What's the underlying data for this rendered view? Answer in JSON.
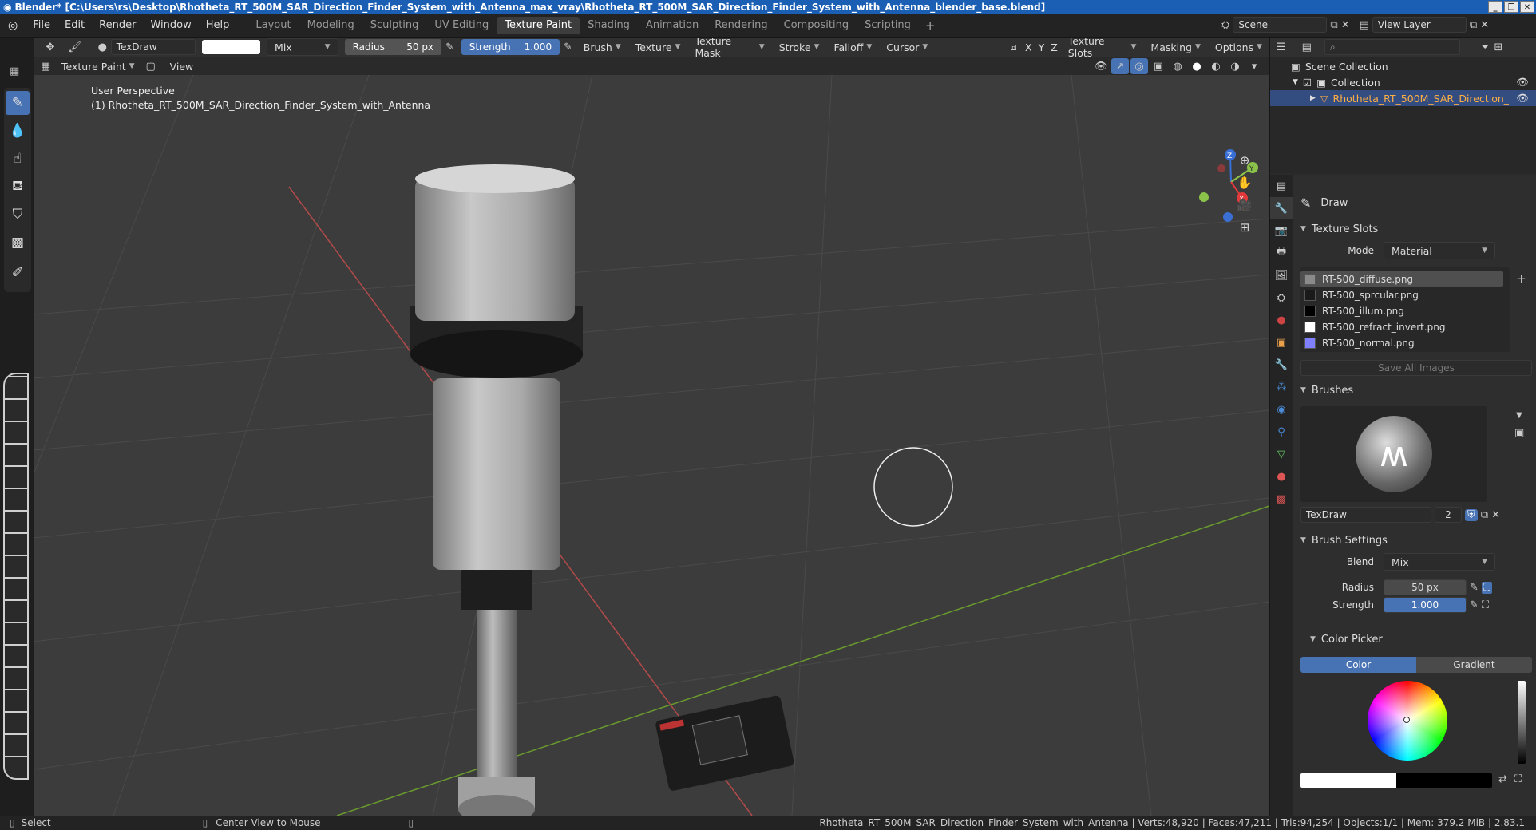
{
  "window": {
    "title": "Blender* [C:\\Users\\rs\\Desktop\\Rhotheta_RT_500M_SAR_Direction_Finder_System_with_Antenna_max_vray\\Rhotheta_RT_500M_SAR_Direction_Finder_System_with_Antenna_blender_base.blend]",
    "controls": [
      "_",
      "❐",
      "✕"
    ]
  },
  "menu": [
    "File",
    "Edit",
    "Render",
    "Window",
    "Help"
  ],
  "workspaces": [
    {
      "label": "Layout",
      "active": false
    },
    {
      "label": "Modeling",
      "active": false
    },
    {
      "label": "Sculpting",
      "active": false
    },
    {
      "label": "UV Editing",
      "active": false
    },
    {
      "label": "Texture Paint",
      "active": true
    },
    {
      "label": "Shading",
      "active": false
    },
    {
      "label": "Animation",
      "active": false
    },
    {
      "label": "Rendering",
      "active": false
    },
    {
      "label": "Compositing",
      "active": false
    },
    {
      "label": "Scripting",
      "active": false
    }
  ],
  "workspace_add": "+",
  "scene": {
    "label": "Scene",
    "view_layer": "View Layer"
  },
  "toolheader": {
    "brush_name": "TexDraw",
    "blend": "Mix",
    "radius_label": "Radius",
    "radius_value": "50 px",
    "strength_label": "Strength",
    "strength_value": "1.000",
    "menus": [
      "Brush",
      "Texture",
      "Texture Mask",
      "Stroke",
      "Falloff",
      "Cursor"
    ],
    "axes": [
      "X",
      "Y",
      "Z"
    ],
    "right_menus": [
      "Texture Slots",
      "Masking",
      "Options"
    ]
  },
  "header2": {
    "mode": "Texture Paint",
    "view": "View"
  },
  "viewport": {
    "perspective": "User Perspective",
    "object_label": "(1) Rhotheta_RT_500M_SAR_Direction_Finder_System_with_Antenna",
    "gizmo_labels": {
      "z": "Z",
      "y": "Y",
      "x": "X"
    }
  },
  "outliner": {
    "scene_collection": "Scene Collection",
    "collection": "Collection",
    "object": "Rhotheta_RT_500M_SAR_Direction_Finder_S"
  },
  "properties": {
    "tool": "Draw",
    "texture_slots": {
      "title": "Texture Slots",
      "mode_label": "Mode",
      "mode_value": "Material",
      "slots": [
        {
          "name": "RT-500_diffuse.png",
          "color": "#8a8a8a",
          "active": true
        },
        {
          "name": "RT-500_sprcular.png",
          "color": "#1a1a1a",
          "active": false
        },
        {
          "name": "RT-500_illum.png",
          "color": "#000000",
          "active": false
        },
        {
          "name": "RT-500_refract_invert.png",
          "color": "#ffffff",
          "active": false
        },
        {
          "name": "RT-500_normal.png",
          "color": "#8080ff",
          "active": false
        }
      ],
      "save_all": "Save All Images"
    },
    "brushes": {
      "title": "Brushes",
      "brush_name": "TexDraw",
      "users": "2"
    },
    "brush_settings": {
      "title": "Brush Settings",
      "blend_label": "Blend",
      "blend_value": "Mix",
      "radius_label": "Radius",
      "radius_value": "50 px",
      "strength_label": "Strength",
      "strength_value": "1.000"
    },
    "color_picker": {
      "title": "Color Picker",
      "tabs": [
        "Color",
        "Gradient"
      ]
    }
  },
  "status": {
    "select": "Select",
    "center_view": "Center View to Mouse",
    "info": "Rhotheta_RT_500M_SAR_Direction_Finder_System_with_Antenna | Verts:48,920 | Faces:47,211 | Tris:94,254 | Objects:1/1 | Mem: 379.2 MiB | 2.83.1"
  },
  "colors": {
    "accent": "#4772b3",
    "selection": "#334d80",
    "title_bar": "#1a5fb4"
  }
}
